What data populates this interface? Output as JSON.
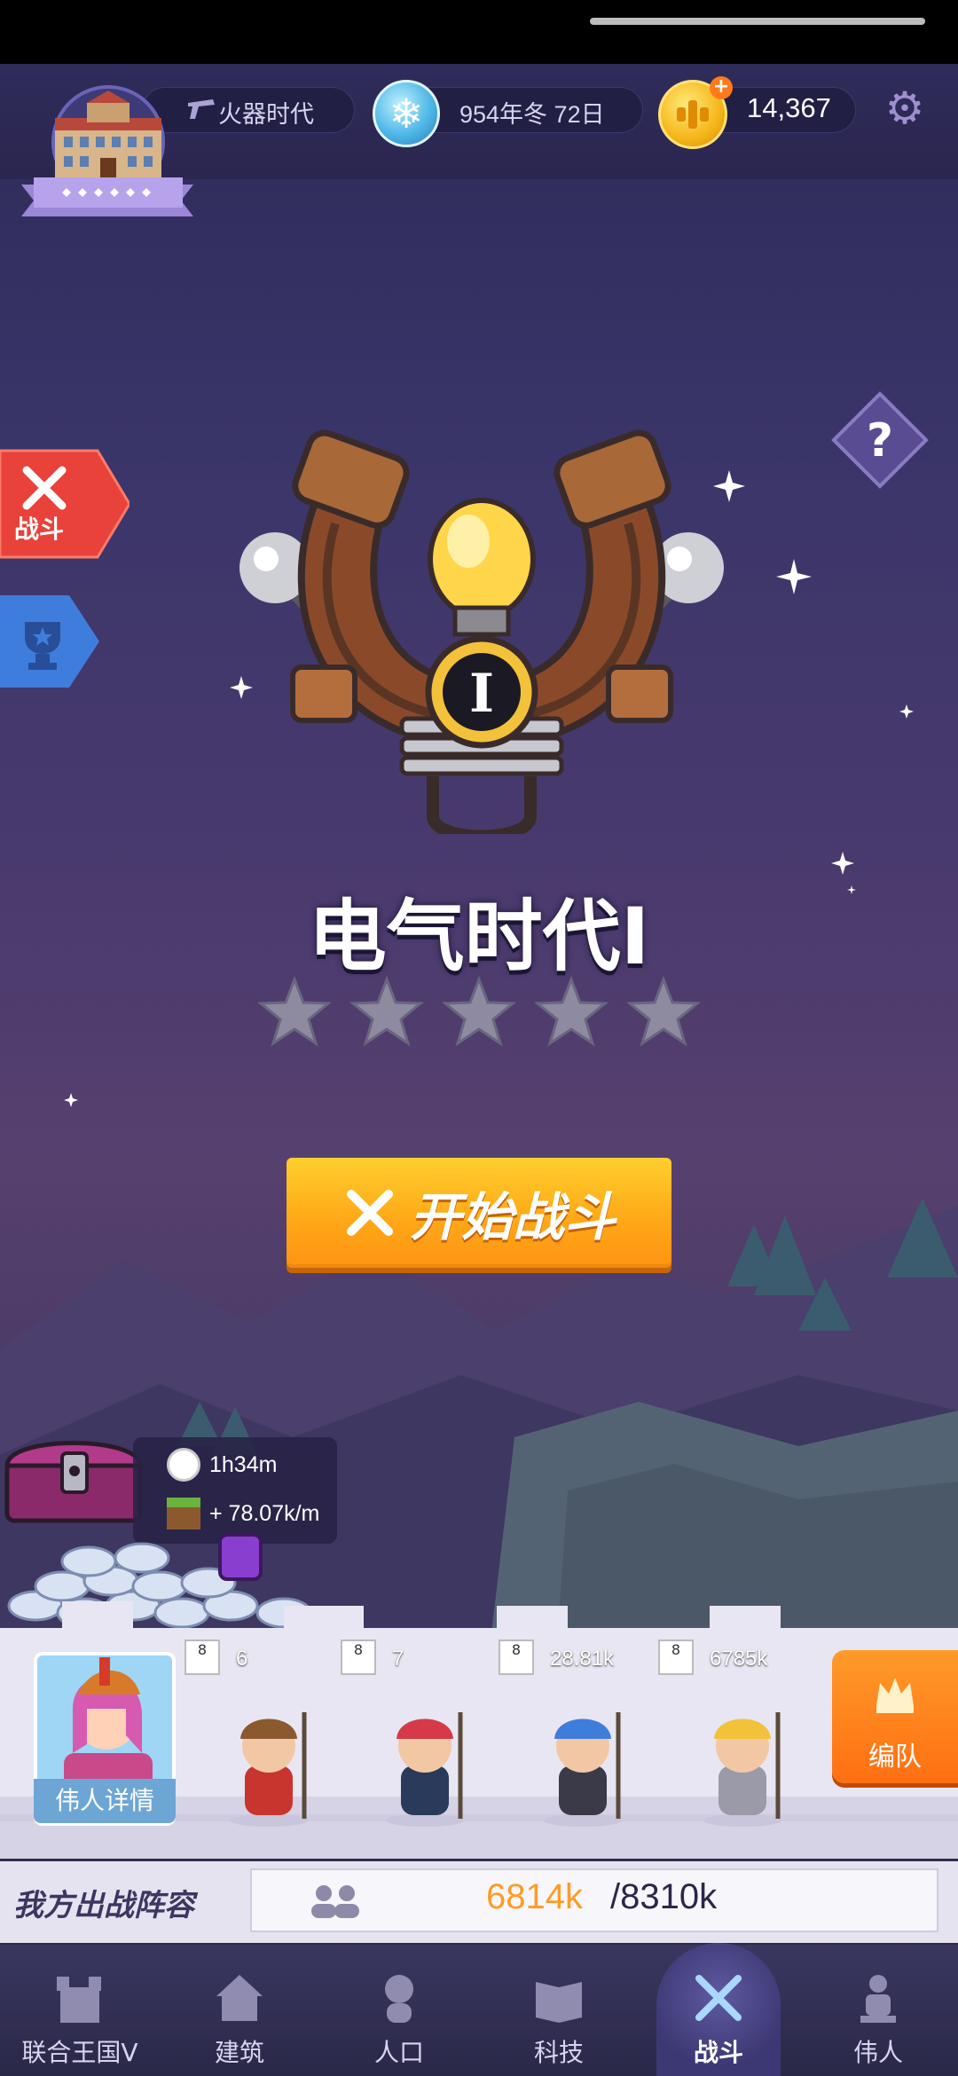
{
  "topbar": {
    "era": "火器时代",
    "date": "954年冬 72日",
    "gold": "14,367"
  },
  "side_tabs": {
    "battle_label": "战斗"
  },
  "stage": {
    "title": "电气时代I",
    "emblem_numeral": "I",
    "stars_filled": 0,
    "stars_total": 5,
    "start_button": "开始战斗"
  },
  "idle_reward": {
    "time": "1h34m",
    "rate": "+ 78.07k/m"
  },
  "formation": {
    "hero_details": "伟人详情",
    "units": [
      {
        "level": "8",
        "count": "6"
      },
      {
        "level": "8",
        "count": "7"
      },
      {
        "level": "8",
        "count": "28.81k"
      },
      {
        "level": "8",
        "count": "6785k"
      }
    ],
    "formation_button": "编队",
    "power_label": "我方出战阵容",
    "power_current": "6814k",
    "power_max": "/8310k"
  },
  "nav": [
    {
      "label": "联合王国V",
      "icon": "castle-icon"
    },
    {
      "label": "建筑",
      "icon": "house-icon"
    },
    {
      "label": "人口",
      "icon": "person-icon"
    },
    {
      "label": "科技",
      "icon": "book-icon"
    },
    {
      "label": "战斗",
      "icon": "crossed-swords-icon",
      "active": true
    },
    {
      "label": "伟人",
      "icon": "statue-icon"
    }
  ],
  "colors": {
    "accent_orange": "#ffa918",
    "power_current": "#ff9c25",
    "background": "#3a3569"
  }
}
